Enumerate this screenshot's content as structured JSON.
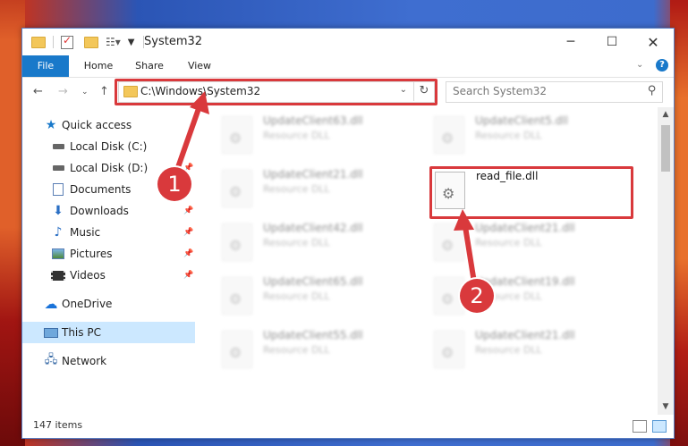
{
  "window": {
    "title": "System32"
  },
  "ribbon": {
    "tabs": [
      "File",
      "Home",
      "Share",
      "View"
    ]
  },
  "address": {
    "path": "C:\\Windows\\System32"
  },
  "search": {
    "placeholder": "Search System32"
  },
  "sidebar": {
    "items": [
      {
        "label": "Quick access",
        "icon": "star-icon"
      },
      {
        "label": "Local Disk (C:)",
        "icon": "drive-icon"
      },
      {
        "label": "Local Disk (D:)",
        "icon": "drive-icon"
      },
      {
        "label": "Documents",
        "icon": "documents-icon"
      },
      {
        "label": "Downloads",
        "icon": "download-icon"
      },
      {
        "label": "Music",
        "icon": "music-icon"
      },
      {
        "label": "Pictures",
        "icon": "pictures-icon"
      },
      {
        "label": "Videos",
        "icon": "videos-icon"
      },
      {
        "label": "OneDrive",
        "icon": "cloud-icon"
      },
      {
        "label": "This PC",
        "icon": "computer-icon"
      },
      {
        "label": "Network",
        "icon": "network-icon"
      }
    ]
  },
  "files": {
    "left": [
      {
        "name": "UpdateClient63.dll",
        "type": "Resource DLL"
      },
      {
        "name": "UpdateClient21.dll",
        "type": "Resource DLL"
      },
      {
        "name": "UpdateClient42.dll",
        "type": "Resource DLL"
      },
      {
        "name": "UpdateClient65.dll",
        "type": "Resource DLL"
      },
      {
        "name": "UpdateClient55.dll",
        "type": "Resource DLL"
      }
    ],
    "right": [
      {
        "name": "UpdateClient5.dll",
        "type": "Resource DLL"
      },
      {
        "name": "read_file.dll",
        "type": ""
      },
      {
        "name": "UpdateClient21.dll",
        "type": "Resource DLL"
      },
      {
        "name": "UpdateClient19.dll",
        "type": "Resource DLL"
      },
      {
        "name": "UpdateClient21.dll",
        "type": "Resource DLL"
      }
    ]
  },
  "status": {
    "count": "147 items"
  },
  "callouts": [
    "1",
    "2"
  ],
  "colors": {
    "accent": "#1979ca",
    "highlight": "#d9393c",
    "selected": "#cce8ff"
  }
}
